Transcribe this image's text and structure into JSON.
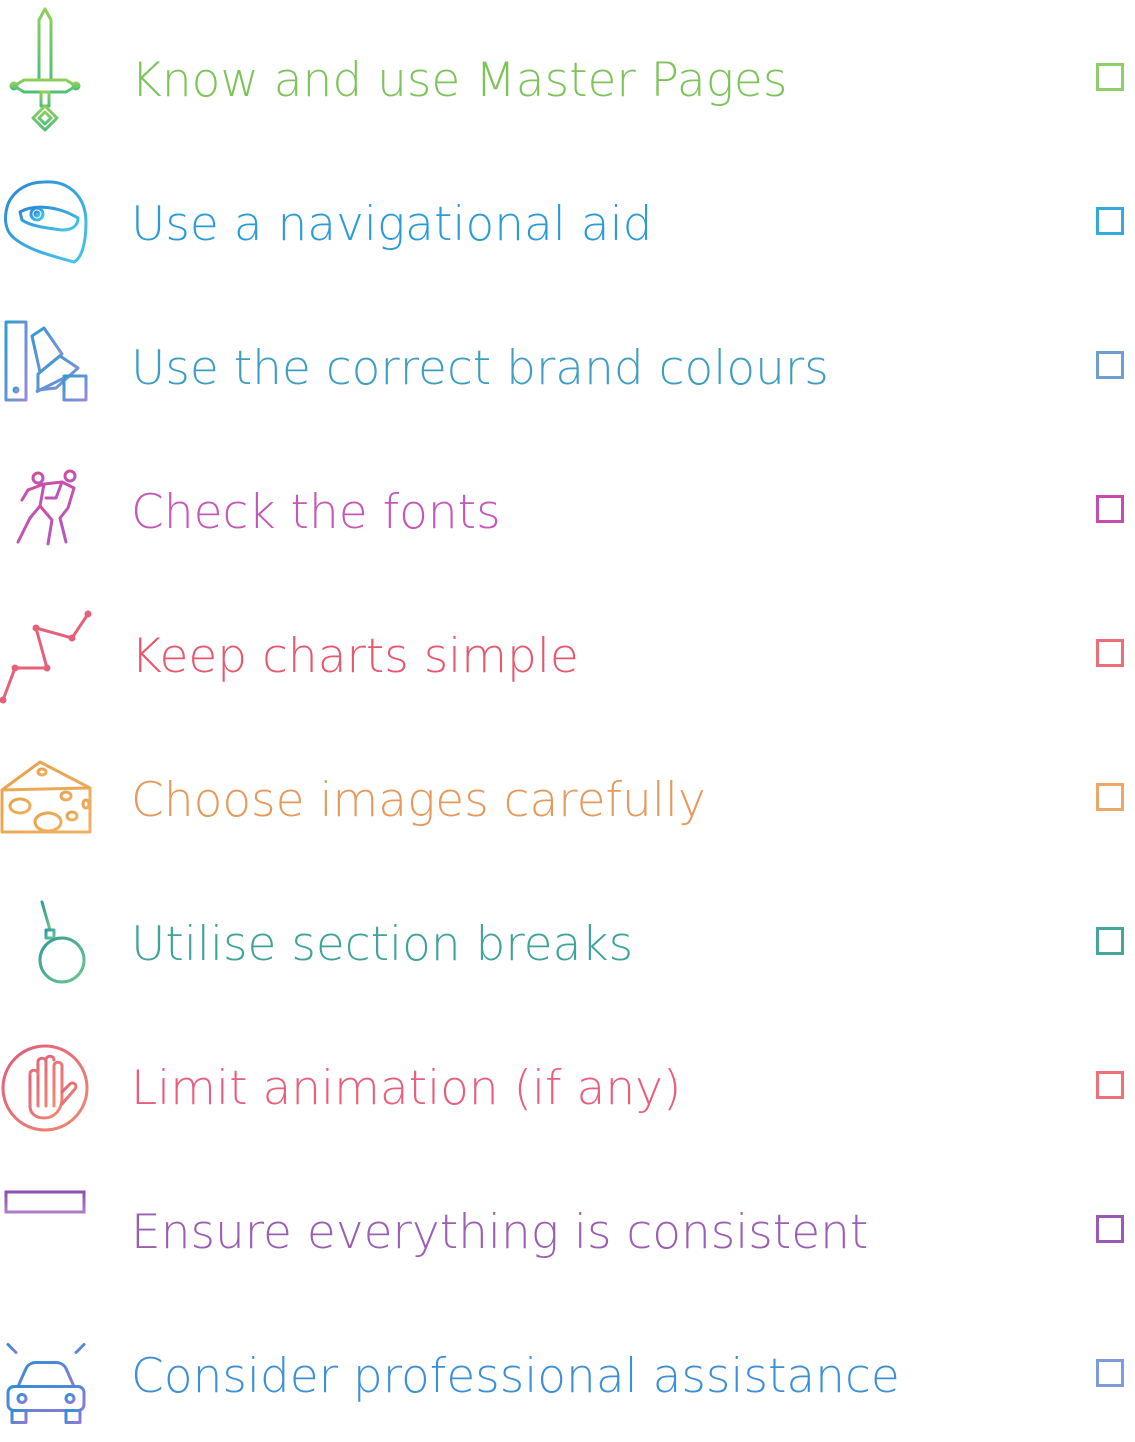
{
  "checklist": {
    "items": [
      {
        "label": "Know and use Master Pages",
        "icon": "sword-icon",
        "color": "#7dc35a",
        "checked": false
      },
      {
        "label": "Use a navigational aid",
        "icon": "helmet-icon",
        "color": "#2b9bd8",
        "checked": false
      },
      {
        "label": "Use the correct brand colours",
        "icon": "colour-swatch-icon",
        "color": "#3d9ec2",
        "checked": false
      },
      {
        "label": "Check the fonts",
        "icon": "dancers-icon",
        "color": "#c458b8",
        "checked": false
      },
      {
        "label": "Keep charts simple",
        "icon": "line-chart-icon",
        "color": "#e5586f",
        "checked": false
      },
      {
        "label": "Choose images carefully",
        "icon": "cheese-icon",
        "color": "#e6995b",
        "checked": false
      },
      {
        "label": "Utilise section breaks",
        "icon": "wrecking-ball-icon",
        "color": "#3fa39a",
        "checked": false
      },
      {
        "label": "Limit animation (if any)",
        "icon": "stop-hand-icon",
        "color": "#e95e7d",
        "checked": false
      },
      {
        "label": "Ensure everything is consistent",
        "icon": "table-grid-icon",
        "color": "#9a5fb2",
        "checked": false
      },
      {
        "label": "Consider professional assistance",
        "icon": "car-icon",
        "color": "#3d8fd8",
        "checked": false
      }
    ]
  }
}
